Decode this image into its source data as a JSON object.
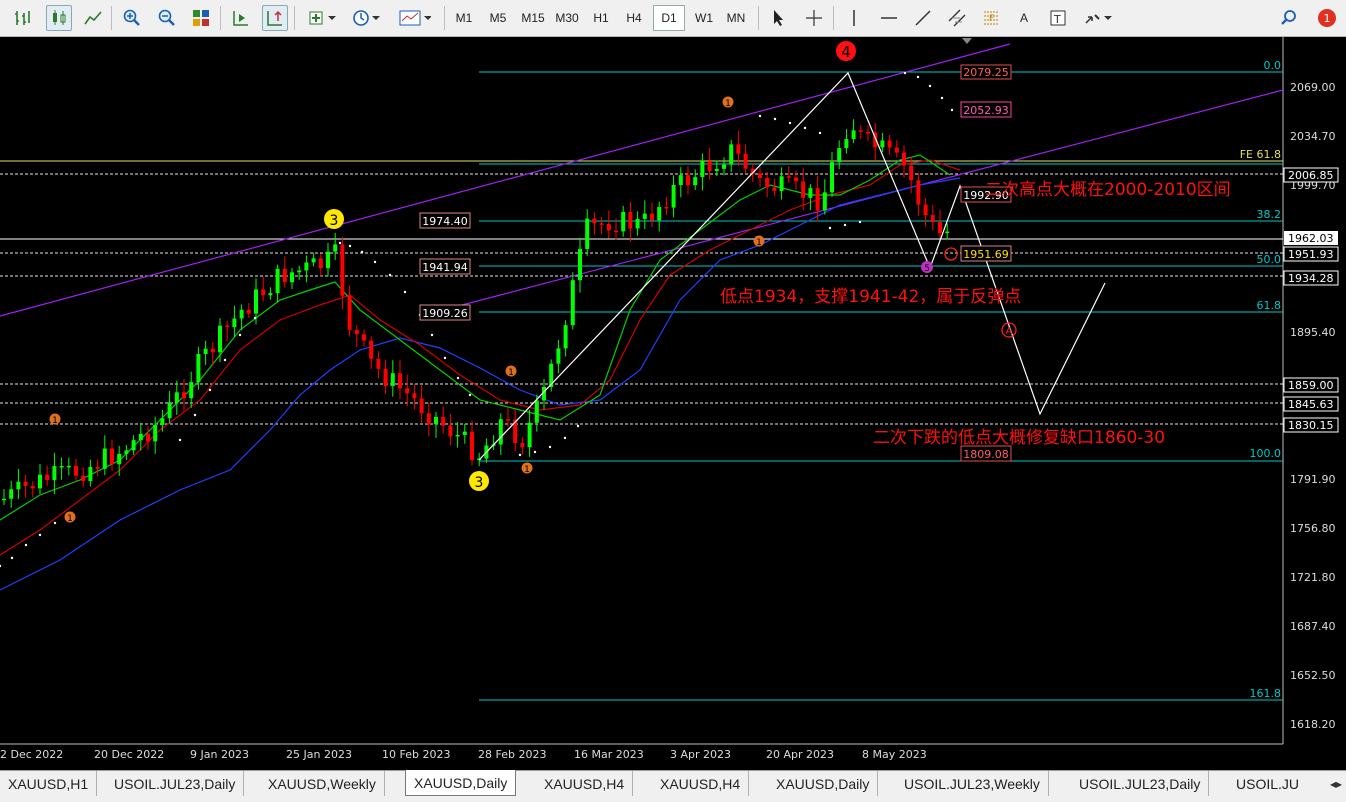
{
  "toolbar": {
    "timeframes": [
      "M1",
      "M5",
      "M15",
      "M30",
      "H1",
      "H4",
      "D1",
      "W1",
      "MN"
    ],
    "active_timeframe": "D1",
    "text_tool": "A",
    "notification_count": "1"
  },
  "chart": {
    "price_axis": [
      "2069.00",
      "2034.70",
      "1999.70",
      "1895.40",
      "1791.90",
      "1756.80",
      "1721.80",
      "1687.40",
      "1652.50",
      "1618.20"
    ],
    "price_boxes": [
      {
        "label": "2006.85",
        "color": "#ffffff",
        "bg": "#000000"
      },
      {
        "label": "1962.03",
        "color": "#000000",
        "bg": "#ffffff"
      },
      {
        "label": "1951.93",
        "color": "#ffffff",
        "bg": "#000000"
      },
      {
        "label": "1934.28",
        "color": "#ffffff",
        "bg": "#000000"
      },
      {
        "label": "1859.00",
        "color": "#ffffff",
        "bg": "#000000"
      },
      {
        "label": "1845.63",
        "color": "#ffffff",
        "bg": "#000000"
      },
      {
        "label": "1830.15",
        "color": "#ffffff",
        "bg": "#000000"
      }
    ],
    "date_axis": [
      "2 Dec 2022",
      "20 Dec 2022",
      "9 Jan 2023",
      "25 Jan 2023",
      "10 Feb 2023",
      "28 Feb 2023",
      "16 Mar 2023",
      "3 Apr 2023",
      "20 Apr 2023",
      "8 May 2023"
    ],
    "fib_levels": [
      "0.0",
      "FE 61.8",
      "38.2",
      "50.0",
      "61.8",
      "100.0",
      "161.8"
    ],
    "level_labels": [
      "1974.40",
      "1941.94",
      "1909.26"
    ],
    "target_labels": [
      "2079.25",
      "2052.93",
      "1992.90",
      "1951.69",
      "1809.08"
    ],
    "wave_labels": [
      "4",
      "3",
      "3",
      "1",
      "1",
      "1",
      "1",
      "1",
      "1",
      "5",
      "A"
    ],
    "annotations": [
      "二次高点大概在2000-2010区间",
      "低点1934，支撑1941-42，属于反弹点",
      "二次下跌的低点大概修复缺口1860-30"
    ],
    "colors": {
      "bull": "#00ff00",
      "bear": "#ff0000",
      "fib": "#00c8c8",
      "channel": "#a020f0",
      "annotation": "#ff0000",
      "ma_fast": "#00d000",
      "ma_mid": "#d00000",
      "ma_slow": "#2040ff"
    }
  },
  "tabs": [
    "XAUUSD,H1",
    "USOIL.JUL23,Daily",
    "XAUUSD,Weekly",
    "XAUUSD,Daily",
    "XAUUSD,H4",
    "XAUUSD,H4",
    "XAUUSD,Daily",
    "USOIL.JUL23,Weekly",
    "USOIL.JUL23,Daily",
    "USOIL.JU"
  ],
  "active_tab": "XAUUSD,Daily"
}
